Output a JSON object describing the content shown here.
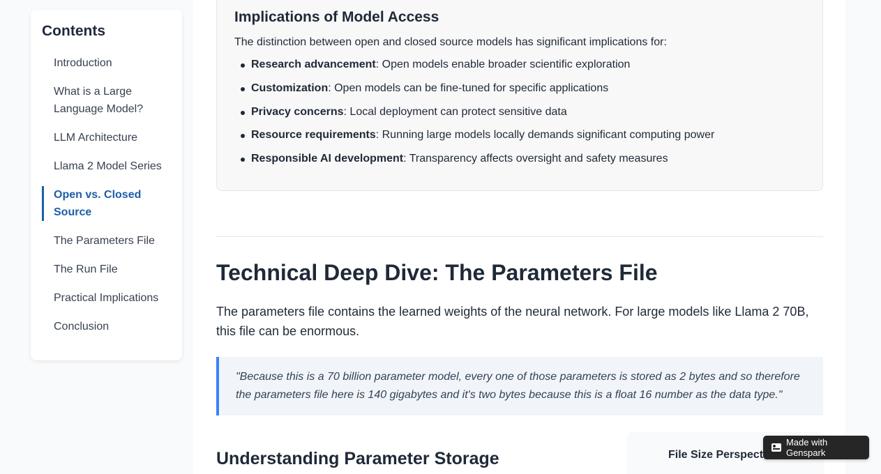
{
  "toc": {
    "title": "Contents",
    "items": [
      {
        "label": "Introduction",
        "active": false
      },
      {
        "label": "What is a Large Language Model?",
        "active": false
      },
      {
        "label": "LLM Architecture",
        "active": false
      },
      {
        "label": "Llama 2 Model Series",
        "active": false
      },
      {
        "label": "Open vs. Closed Source",
        "active": true
      },
      {
        "label": "The Parameters File",
        "active": false
      },
      {
        "label": "The Run File",
        "active": false
      },
      {
        "label": "Practical Implications",
        "active": false
      },
      {
        "label": "Conclusion",
        "active": false
      }
    ]
  },
  "access": {
    "title": "Implications of Model Access",
    "intro": "The distinction between open and closed source models has significant implications for:",
    "items": [
      {
        "term": "Research advancement",
        "desc": ": Open models enable broader scientific exploration"
      },
      {
        "term": "Customization",
        "desc": ": Open models can be fine-tuned for specific applications"
      },
      {
        "term": "Privacy concerns",
        "desc": ": Local deployment can protect sensitive data"
      },
      {
        "term": "Resource requirements",
        "desc": ": Running large models locally demands significant computing power"
      },
      {
        "term": "Responsible AI development",
        "desc": ": Transparency affects oversight and safety measures"
      }
    ]
  },
  "section": {
    "title": "Technical Deep Dive: The Parameters File",
    "paragraph": "The parameters file contains the learned weights of the neural network. For large models like Llama 2 70B, this file can be enormous.",
    "quote": "\"Because this is a 70 billion parameter model, every one of those parameters is stored as 2 bytes and so therefore the parameters file here is 140 gigabytes and it's two bytes because this is a float 16 number as the data type.\"",
    "subtitle": "Understanding Parameter Storage",
    "card_title": "File Size Perspective"
  },
  "badge": {
    "label": "Made with Genspark"
  }
}
